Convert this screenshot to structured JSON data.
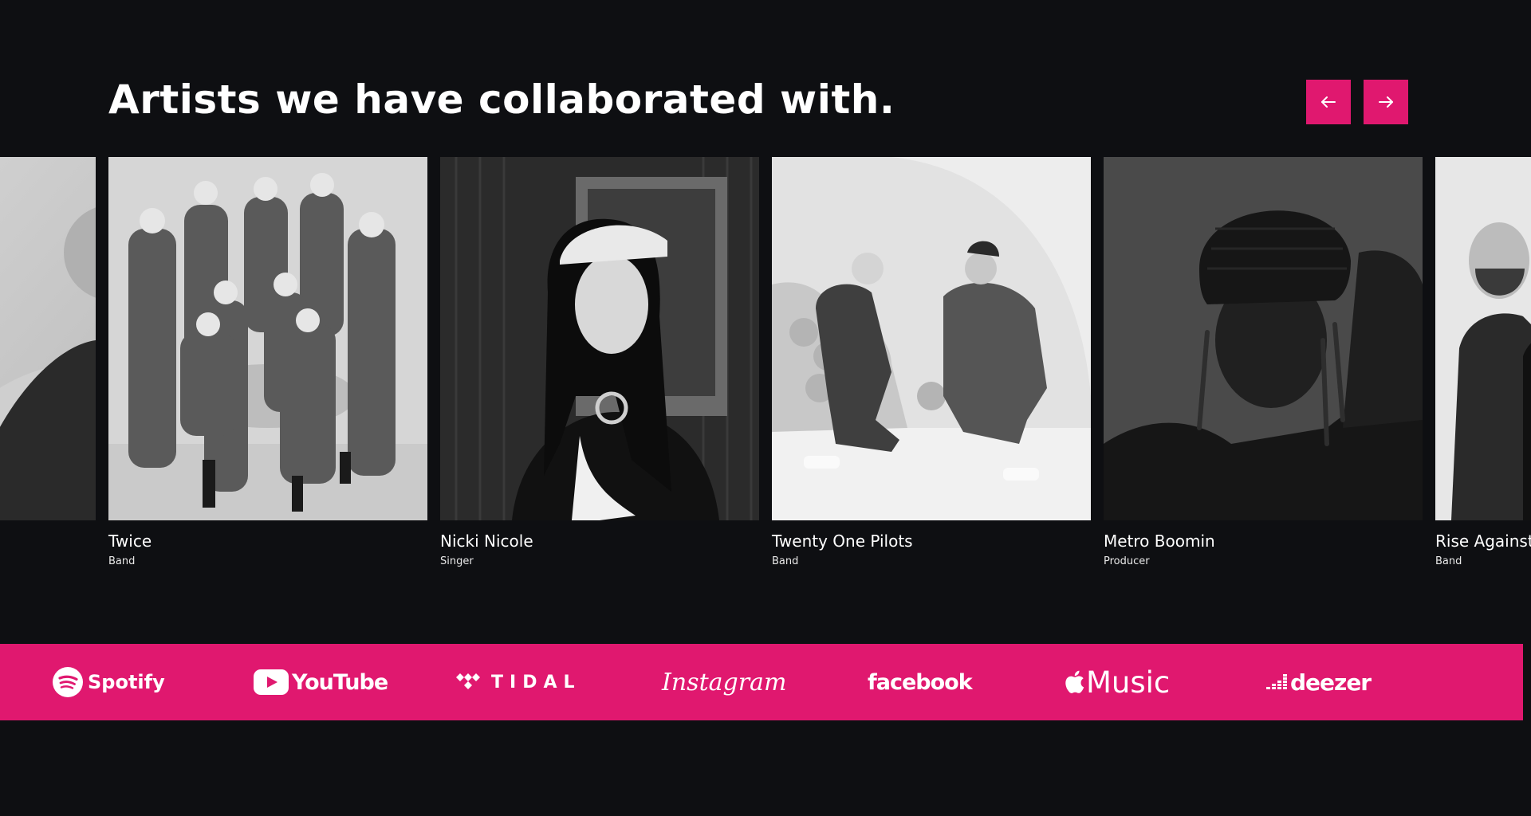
{
  "section": {
    "heading": "Artists we have collaborated with."
  },
  "controls": {
    "prev_icon": "arrow-left-icon",
    "next_icon": "arrow-right-icon",
    "accent_color": "#e0186f"
  },
  "artists": [
    {
      "name": "",
      "role": ""
    },
    {
      "name": "Twice",
      "role": "Band"
    },
    {
      "name": "Nicki Nicole",
      "role": "Singer"
    },
    {
      "name": "Twenty One Pilots",
      "role": "Band"
    },
    {
      "name": "Metro Boomin",
      "role": "Producer"
    },
    {
      "name": "Rise Against",
      "role": "Band"
    }
  ],
  "platforms": [
    {
      "name": "Spotify",
      "icon": "spotify-icon"
    },
    {
      "name": "YouTube",
      "icon": "youtube-icon"
    },
    {
      "name": "TIDAL",
      "icon": "tidal-icon"
    },
    {
      "name": "Instagram",
      "icon": "instagram-icon"
    },
    {
      "name": "facebook",
      "icon": "facebook-icon"
    },
    {
      "name": "Music",
      "icon": "apple-icon"
    },
    {
      "name": "deezer",
      "icon": "deezer-icon"
    }
  ],
  "colors": {
    "background": "#0e0f12",
    "accent": "#e0186f",
    "text": "#ffffff"
  }
}
